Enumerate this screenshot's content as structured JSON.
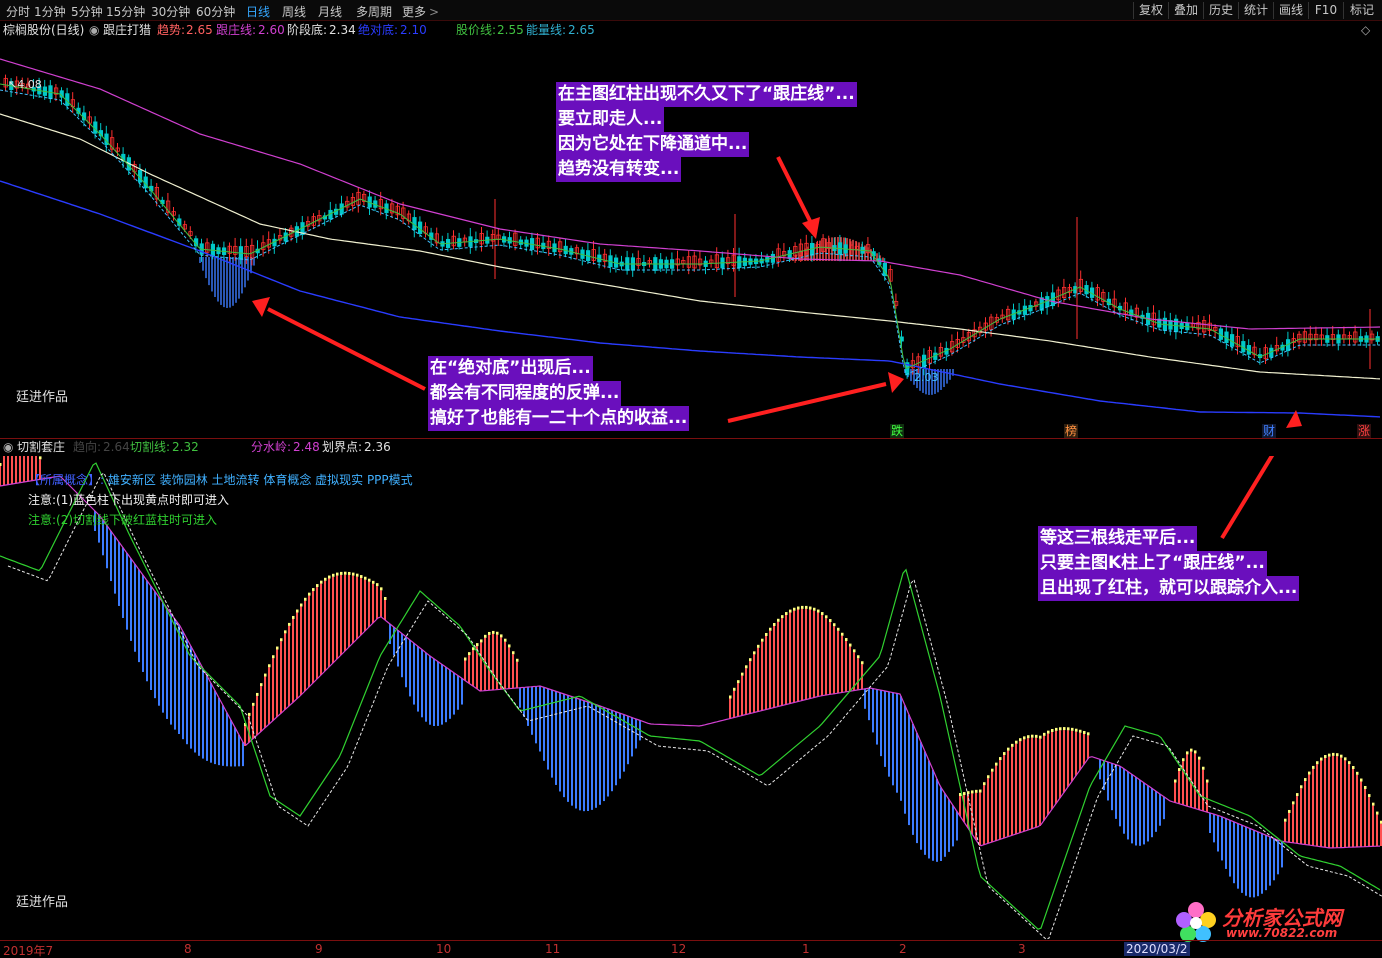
{
  "toolbar": {
    "timeframes": [
      "分时",
      "1分钟",
      "5分钟",
      "15分钟",
      "30分钟",
      "60分钟",
      "日线",
      "周线",
      "月线",
      "多周期",
      "更多"
    ],
    "active_timeframe": "日线",
    "right_buttons": [
      "复权",
      "叠加",
      "历史",
      "统计",
      "画线",
      "F10",
      "标记"
    ]
  },
  "main_info": {
    "stock": "棕榈股份(日线)",
    "indicator": "跟庄打猎",
    "trend_label": "趋势:",
    "trend_value": "2.65",
    "follow_label": "跟庄线:",
    "follow_value": "2.60",
    "stage_label": "阶段底:",
    "stage_value": "2.34",
    "abs_label": "绝对底:",
    "abs_value": "2.10",
    "price_label": "股价线:",
    "price_value": "2.55",
    "energy_label": "能量线:",
    "energy_value": "2.65"
  },
  "main_chart": {
    "price_top_label": "4.08",
    "price_bottom_label": "2.03",
    "author": "廷进作品",
    "markers": [
      "跌",
      "榜",
      "财",
      "涨"
    ]
  },
  "annotations": {
    "top": [
      "在主图红柱出现不久又下了“跟庄线”...",
      "要立即走人...",
      "因为它处在下降通道中...",
      "趋势没有转变..."
    ],
    "middle": [
      "在“绝对底”出现后...",
      "都会有不同程度的反弹...",
      "搞好了也能有一二十个点的收益..."
    ],
    "right": [
      "等这三根线走平后...",
      "只要主图K柱上了“跟庄线”...",
      "且出现了红柱，就可以跟踪介入..."
    ]
  },
  "sub_info": {
    "indicator": "切割套庄",
    "dim_label": "趋向:",
    "dim_value": "2.64",
    "cut_label": "切割线:",
    "cut_value": "2.32",
    "water_label": "分水岭:",
    "water_value": "2.48",
    "bound_label": "划界点:",
    "bound_value": "2.36"
  },
  "sub_notes": {
    "concept_label": "【所属概念】:",
    "concept_value": "雄安新区 装饰园林 土地流转 体育概念 虚拟现实 PPP模式",
    "note1": "注意:(1)蓝色柱下出现黄点时即可进入",
    "note2": "注意:(2)切割线下破红蓝柱时可进入",
    "author": "廷进作品"
  },
  "date_axis": {
    "labels": [
      "2019年7",
      "8",
      "9",
      "10",
      "11",
      "12",
      "1",
      "2",
      "3",
      "2020/03/2"
    ]
  },
  "watermark": {
    "title": "分析家公式网",
    "url": "www.70822.com"
  },
  "colors": {
    "background": "#000000",
    "up_candle": "#ff3030",
    "down_candle": "#00c8c8",
    "follow_line": "#d040d0",
    "trend_line": "#f0f0d0",
    "abs_line": "#2a3cff",
    "red_bar": "#ff5050",
    "blue_bar": "#3c7cff",
    "annotation_bg": "#6a0fbd"
  }
}
